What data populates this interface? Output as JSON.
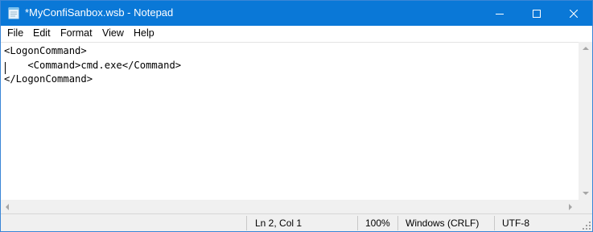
{
  "window": {
    "title": "*MyConfiSanbox.wsb - Notepad",
    "app_icon": "notepad-icon",
    "controls": [
      "minimize-icon",
      "maximize-icon",
      "close-icon"
    ],
    "titlebar_color": "#0a78d7"
  },
  "menu": {
    "items": [
      {
        "label": "File"
      },
      {
        "label": "Edit"
      },
      {
        "label": "Format"
      },
      {
        "label": "View"
      },
      {
        "label": "Help"
      }
    ]
  },
  "editor": {
    "content": "<LogonCommand>\n    <Command>cmd.exe</Command>\n</LogonCommand>"
  },
  "status": {
    "position": "Ln 2, Col 1",
    "zoom": "100%",
    "line_ending": "Windows (CRLF)",
    "encoding": "UTF-8"
  }
}
